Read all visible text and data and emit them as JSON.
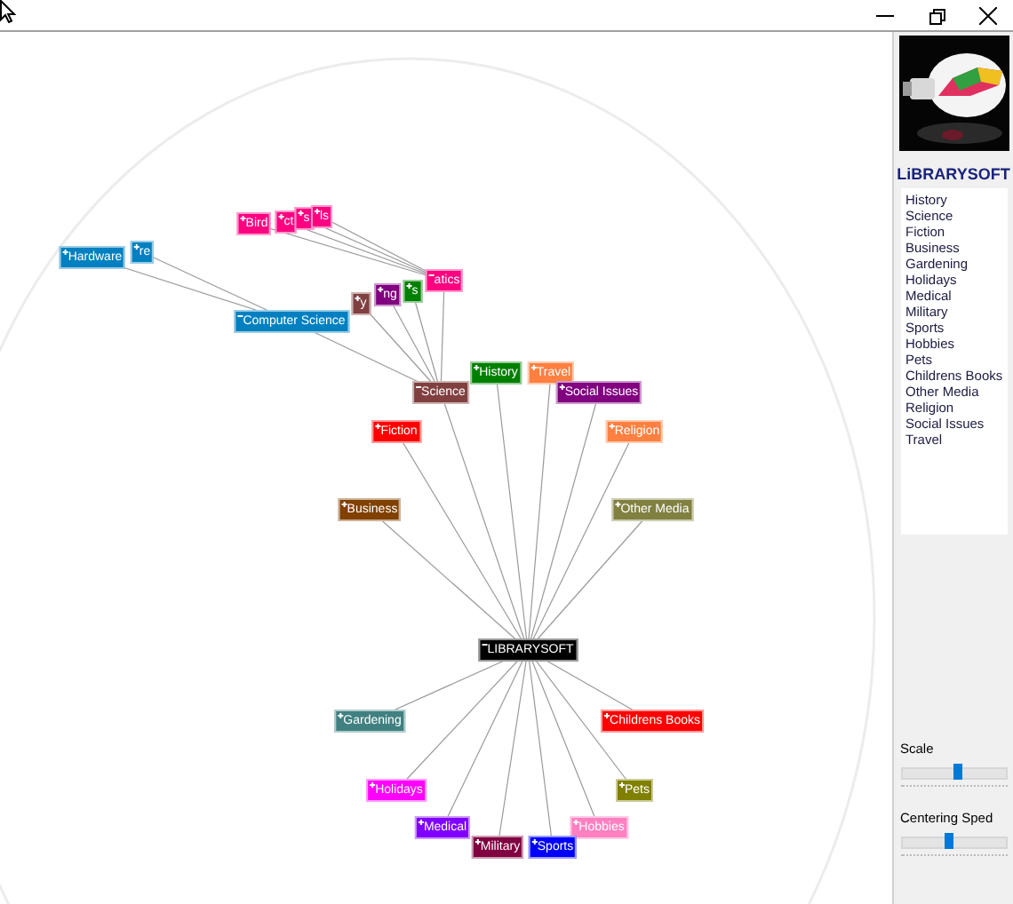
{
  "tree": {
    "label": "LIBRARYSOFT",
    "color": "#000000",
    "expanded": true,
    "children": [
      {
        "label": "History",
        "color": "#008000",
        "expanded": false
      },
      {
        "label": "Travel",
        "color": "#ff8040",
        "expanded": false
      },
      {
        "label": "Science",
        "color": "#804040",
        "expanded": true,
        "children": [
          {
            "label": "Computer Science",
            "color": "#0080c0",
            "expanded": true,
            "children": [
              {
                "label": "Hardware",
                "color": "#0080c0",
                "expanded": false
              },
              {
                "label": "re",
                "color": "#0080c0",
                "expanded": false
              }
            ]
          },
          {
            "label": "y",
            "color": "#804040",
            "expanded": false
          },
          {
            "label": "ng",
            "color": "#800080",
            "expanded": false
          },
          {
            "label": "s",
            "color": "#008000",
            "expanded": false
          },
          {
            "label": "atics",
            "color": "#ff0080",
            "expanded": true,
            "children": [
              {
                "label": "Bird",
                "color": "#ff0080",
                "expanded": false
              },
              {
                "label": "ct",
                "color": "#ff0080",
                "expanded": false
              },
              {
                "label": "s",
                "color": "#ff0080",
                "expanded": false
              },
              {
                "label": "ls",
                "color": "#ff0080",
                "expanded": false
              }
            ]
          }
        ]
      },
      {
        "label": "Social Issues",
        "color": "#800080",
        "expanded": false
      },
      {
        "label": "Fiction",
        "color": "#ff0000",
        "expanded": false
      },
      {
        "label": "Religion",
        "color": "#ff8040",
        "expanded": false
      },
      {
        "label": "Business",
        "color": "#804000",
        "expanded": false
      },
      {
        "label": "Other Media",
        "color": "#808040",
        "expanded": false
      },
      {
        "label": "Gardening",
        "color": "#408080",
        "expanded": false
      },
      {
        "label": "Childrens Books",
        "color": "#ff0000",
        "expanded": false
      },
      {
        "label": "Holidays",
        "color": "#ff00ff",
        "expanded": false
      },
      {
        "label": "Pets",
        "color": "#808000",
        "expanded": false
      },
      {
        "label": "Medical",
        "color": "#8000ff",
        "expanded": false
      },
      {
        "label": "Hobbies",
        "color": "#ff80c0",
        "expanded": false
      },
      {
        "label": "Military",
        "color": "#800040",
        "expanded": false
      },
      {
        "label": "Sports",
        "color": "#0000ff",
        "expanded": false
      }
    ]
  },
  "sidebar": {
    "title": "LiBRARYSOFT",
    "items": [
      {
        "label": "History"
      },
      {
        "label": "Science"
      },
      {
        "label": "Fiction"
      },
      {
        "label": "Business"
      },
      {
        "label": "Gardening"
      },
      {
        "label": "Holidays"
      },
      {
        "label": "Medical"
      },
      {
        "label": "Military"
      },
      {
        "label": "Sports"
      },
      {
        "label": "Hobbies"
      },
      {
        "label": "Pets"
      },
      {
        "label": "Childrens Books"
      },
      {
        "label": "Other Media"
      },
      {
        "label": "Religion"
      },
      {
        "label": "Social Issues"
      },
      {
        "label": "Travel"
      }
    ],
    "sliders": [
      {
        "label": "Scale",
        "level": 0.55
      },
      {
        "label": "Centering Sped",
        "level": 0.45
      }
    ]
  }
}
